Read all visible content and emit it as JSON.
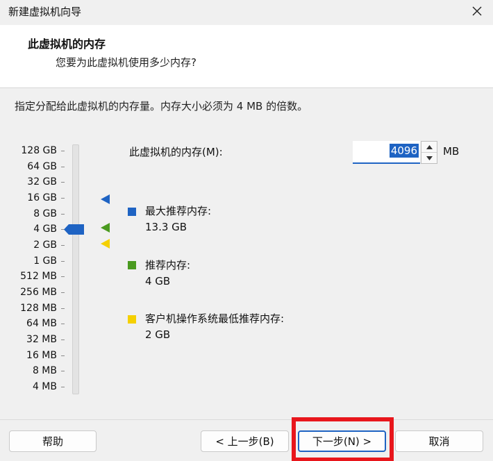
{
  "window": {
    "title": "新建虚拟机向导",
    "close_icon": "close-icon"
  },
  "header": {
    "title": "此虚拟机的内存",
    "subtitle": "您要为此虚拟机使用多少内存?"
  },
  "instruction": "指定分配给此虚拟机的内存量。内存大小必须为 4 MB 的倍数。",
  "scale": {
    "labels": [
      "128 GB",
      "64 GB",
      "32 GB",
      "16 GB",
      "8 GB",
      "4 GB",
      "2 GB",
      "1 GB",
      "512 MB",
      "256 MB",
      "128 MB",
      "64 MB",
      "32 MB",
      "16 MB",
      "8 MB",
      "4 MB"
    ],
    "selected": "4 GB",
    "marker_max_recommended": "16 GB",
    "marker_recommended": "4 GB",
    "marker_guest_min": "2 GB"
  },
  "memory": {
    "label": "此虚拟机的内存(M):",
    "value": "4096",
    "unit": "MB"
  },
  "legend": {
    "max_recommended": {
      "title": "最大推荐内存:",
      "value": "13.3 GB",
      "color": "#1e63c3"
    },
    "recommended": {
      "title": "推荐内存:",
      "value": "4 GB",
      "color": "#4a9a1f"
    },
    "guest_min": {
      "title": "客户机操作系统最低推荐内存:",
      "value": "2 GB",
      "color": "#f5d000"
    }
  },
  "buttons": {
    "help": "帮助",
    "back": "< 上一步(B)",
    "next": "下一步(N) >",
    "cancel": "取消"
  },
  "colors": {
    "accent": "#1e63c3",
    "highlight": "#e8161c"
  }
}
